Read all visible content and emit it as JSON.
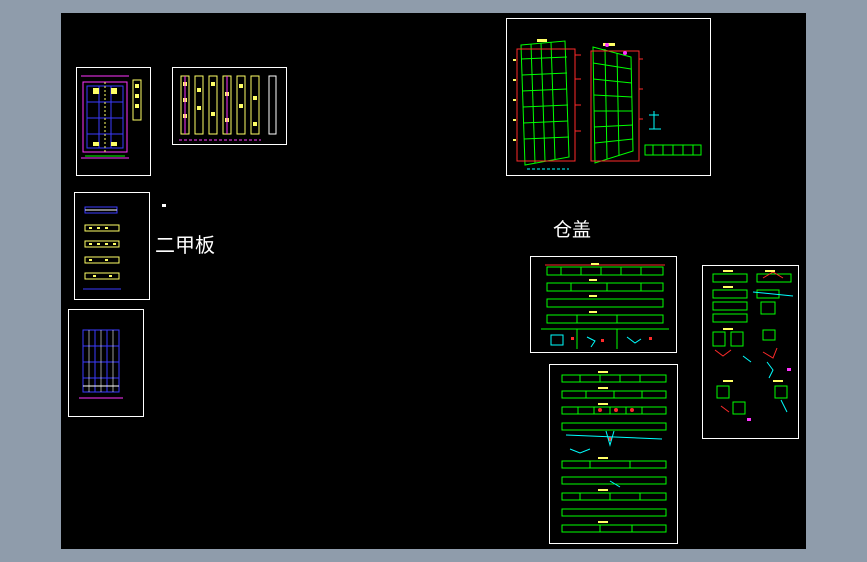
{
  "labels": {
    "erjia_ban": "二甲板",
    "cang_gai": "仓盖"
  },
  "colors": {
    "workspace_bg": "#8f9cab",
    "canvas_bg": "#000000",
    "sheet_border": "#ffffff",
    "green": "#00ff00",
    "red": "#ff2a2a",
    "yellow": "#ffff66",
    "cyan": "#00ffff",
    "blue": "#3b3bff",
    "magenta": "#ff33ff"
  },
  "sheets": [
    "sheet-deck-plan",
    "sheet-yellow-sections",
    "sheet-deck-details",
    "sheet-blue-plan",
    "sheet-hull-structure",
    "sheet-hatch-cover-1",
    "sheet-hatch-cover-2",
    "sheet-hatch-details"
  ]
}
